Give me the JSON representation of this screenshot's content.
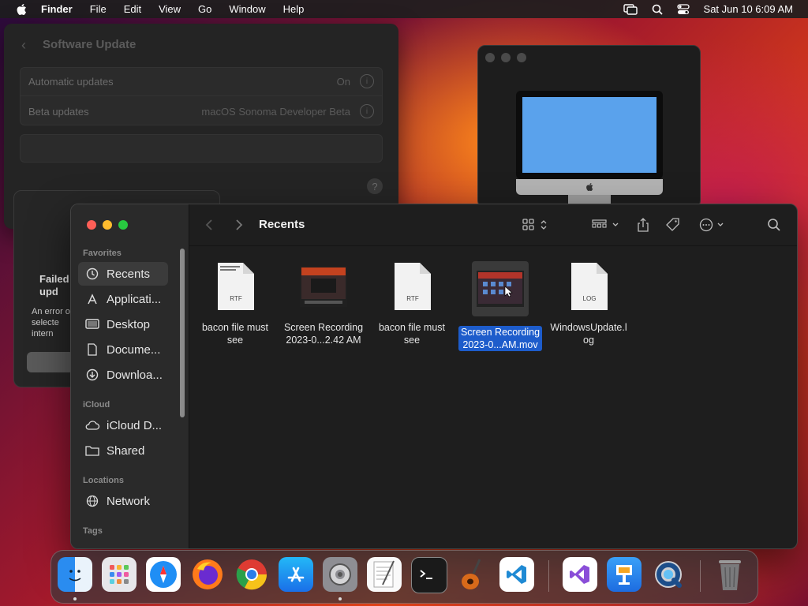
{
  "menubar": {
    "app_name": "Finder",
    "items": [
      "File",
      "Edit",
      "View",
      "Go",
      "Window",
      "Help"
    ],
    "clock": "Sat Jun 10  6:09 AM"
  },
  "settings": {
    "title": "Software Update",
    "rows": [
      {
        "label": "Automatic updates",
        "value": "On"
      },
      {
        "label": "Beta updates",
        "value": "macOS Sonoma Developer Beta"
      }
    ],
    "help": "?"
  },
  "alert": {
    "title": "Failed\nupd",
    "body": "An error o\nselecte\nintern"
  },
  "finder": {
    "toolbar_title": "Recents",
    "sidebar": {
      "favorites_header": "Favorites",
      "favorites": [
        {
          "label": "Recents",
          "icon": "clock-icon"
        },
        {
          "label": "Applicati...",
          "icon": "applications-icon"
        },
        {
          "label": "Desktop",
          "icon": "desktop-icon"
        },
        {
          "label": "Docume...",
          "icon": "document-icon"
        },
        {
          "label": "Downloa...",
          "icon": "download-icon"
        }
      ],
      "icloud_header": "iCloud",
      "icloud": [
        {
          "label": "iCloud D...",
          "icon": "cloud-icon"
        },
        {
          "label": "Shared",
          "icon": "shared-folder-icon"
        }
      ],
      "locations_header": "Locations",
      "locations": [
        {
          "label": "Network",
          "icon": "globe-icon"
        }
      ],
      "tags_header": "Tags"
    },
    "files": [
      {
        "line1": "bacon file must",
        "line2": "see",
        "type": "RTF",
        "thumb_text": "Bacon caveat\nmust texts"
      },
      {
        "line1": "Screen Recording",
        "line2": "2023-0...2.42 AM",
        "type": "video"
      },
      {
        "line1": "bacon file must",
        "line2": "see",
        "type": "RTF"
      },
      {
        "line1": "Screen Recording",
        "line2": "2023-0...AM.mov",
        "type": "video",
        "selected": true
      },
      {
        "line1": "WindowsUpdate.l",
        "line2": "og",
        "type": "LOG"
      }
    ]
  },
  "dock": {
    "apps": [
      "Finder",
      "Launchpad",
      "Safari",
      "Firefox",
      "Chrome",
      "App Store",
      "System Settings",
      "TextEdit",
      "Terminal",
      "GarageBand",
      "Visual Studio Code",
      "Visual Studio",
      "Keynote",
      "QuickTime Player",
      "Trash"
    ]
  },
  "colors": {
    "selection": "#1d5ccb",
    "close": "#fe5f57",
    "minimize": "#febc2e",
    "zoom": "#28c840"
  }
}
